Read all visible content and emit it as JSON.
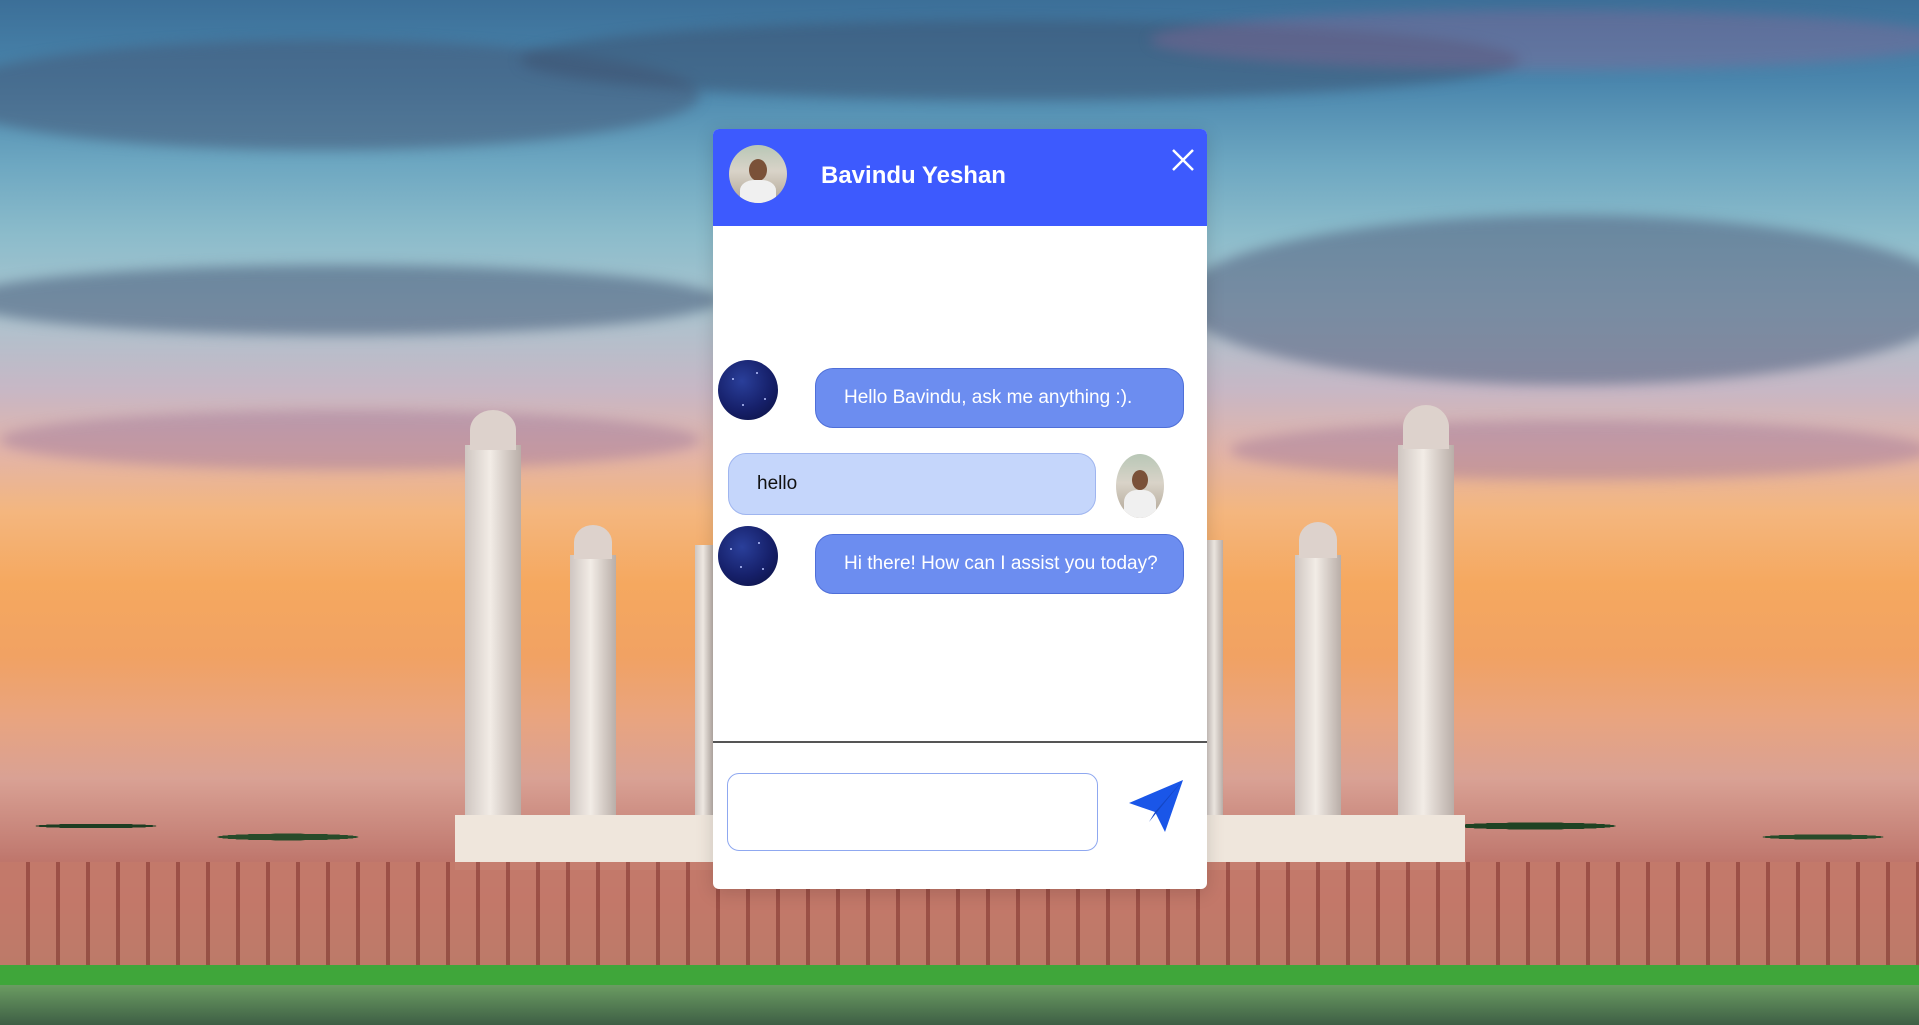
{
  "header": {
    "contact_name": "Bavindu Yeshan",
    "avatar_icon": "user-photo-avatar",
    "close_icon": "close-icon"
  },
  "messages": [
    {
      "sender": "bot",
      "text": "Hello Bavindu, ask me anything :).",
      "avatar_icon": "bot-avatar"
    },
    {
      "sender": "user",
      "text": "hello",
      "avatar_icon": "user-photo-avatar"
    },
    {
      "sender": "bot",
      "text": "Hi there! How can I assist you today?",
      "avatar_icon": "bot-avatar"
    }
  ],
  "composer": {
    "input_value": "",
    "send_icon": "send-icon"
  },
  "colors": {
    "header_bg": "#3d5afe",
    "bot_bubble": "#6c8df0",
    "user_bubble": "#c5d6fb"
  }
}
